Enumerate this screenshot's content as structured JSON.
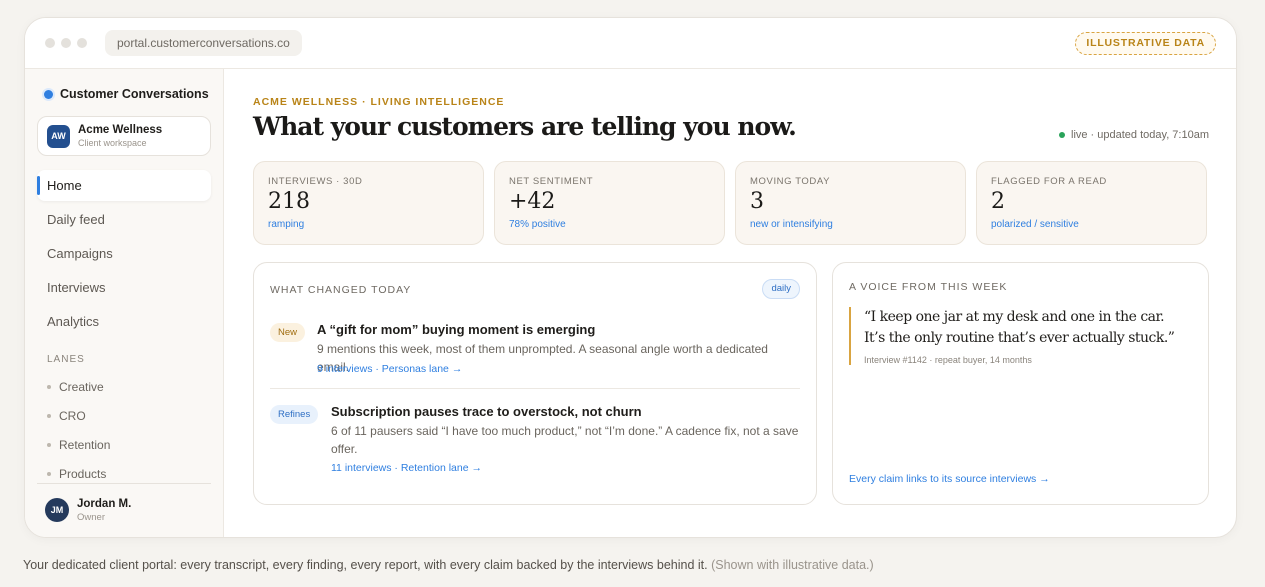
{
  "browser": {
    "url": "portal.customerconversations.co",
    "badge": "ILLUSTRATIVE DATA"
  },
  "sidebar": {
    "brand": "Customer Conversations",
    "workspace": {
      "initials": "AW",
      "name": "Acme Wellness",
      "sub": "Client workspace"
    },
    "nav": [
      {
        "label": "Home",
        "active": true
      },
      {
        "label": "Daily feed"
      },
      {
        "label": "Campaigns"
      },
      {
        "label": "Interviews"
      },
      {
        "label": "Analytics"
      }
    ],
    "lanes_title": "LANES",
    "lanes": [
      "Creative",
      "CRO",
      "Retention",
      "Products"
    ],
    "user": {
      "initials": "JM",
      "name": "Jordan M.",
      "role": "Owner"
    }
  },
  "main": {
    "eyebrow": "ACME WELLNESS · LIVING INTELLIGENCE",
    "headline": "What your customers are telling you now.",
    "live": "live · updated today, 7:10am",
    "stats": [
      {
        "label": "INTERVIEWS · 30D",
        "value": "218",
        "sub": "ramping"
      },
      {
        "label": "NET SENTIMENT",
        "value": "+42",
        "sub": "78% positive"
      },
      {
        "label": "MOVING TODAY",
        "value": "3",
        "sub": "new or intensifying"
      },
      {
        "label": "FLAGGED FOR A READ",
        "value": "2",
        "sub": "polarized / sensitive"
      }
    ],
    "changes": {
      "title": "WHAT CHANGED TODAY",
      "pill": "daily",
      "items": [
        {
          "badge": "New",
          "title": "A “gift for mom” buying moment is emerging",
          "body": "9 mentions this week, most of them unprompted. A seasonal angle worth a dedicated email.",
          "link": "9 interviews · Personas lane →"
        },
        {
          "badge": "Refines",
          "title": "Subscription pauses trace to overstock, not churn",
          "body": "6 of 11 pausers said “I have too much product,” not “I’m done.” A cadence fix, not a save offer.",
          "link": "11 interviews · Retention lane →"
        }
      ]
    },
    "voice": {
      "title": "A VOICE FROM THIS WEEK",
      "quote": "“I keep one jar at my desk and one in the car. It’s the only routine that’s ever actually stuck.”",
      "meta": "Interview #1142 · repeat buyer, 14 months",
      "link": "Every claim links to its source interviews →"
    }
  },
  "caption": {
    "text": "Your dedicated client portal: every transcript, every finding, every report, with every claim backed by the interviews behind it.",
    "muted": "(Shown with illustrative data.)"
  }
}
